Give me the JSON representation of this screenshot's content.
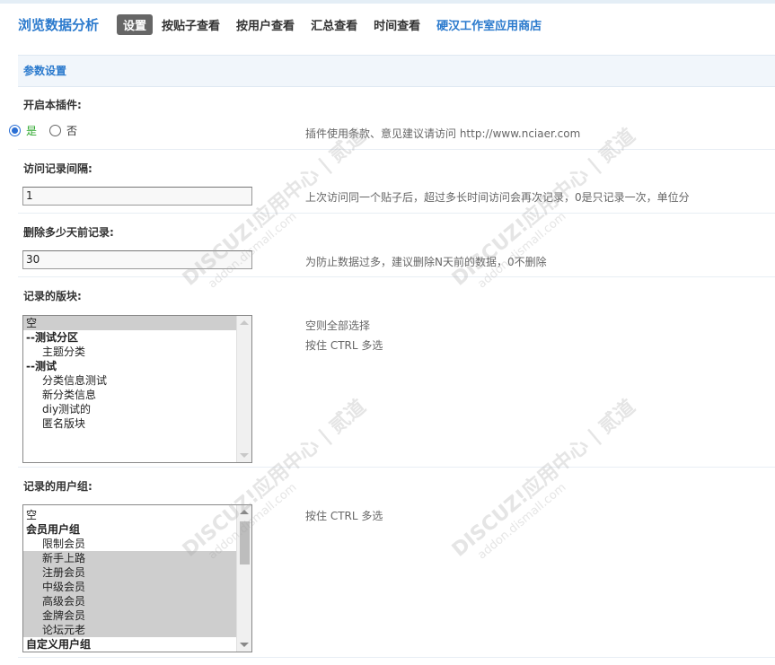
{
  "header": {
    "app_title": "浏览数据分析",
    "nav": [
      {
        "label": "设置",
        "active": true
      },
      {
        "label": "按贴子查看"
      },
      {
        "label": "按用户查看"
      },
      {
        "label": "汇总查看"
      },
      {
        "label": "时间查看"
      },
      {
        "label": "硬汉工作室应用商店"
      }
    ]
  },
  "section": {
    "title": "参数设置"
  },
  "enable_plugin": {
    "label": "开启本插件:",
    "yes_label": "是",
    "no_label": "否",
    "selected": "yes",
    "hint": "插件使用条款、意见建议请访问 http://www.nciaer.com"
  },
  "interval": {
    "label": "访问记录间隔:",
    "value": "1",
    "hint": "上次访问同一个贴子后，超过多长时间访问会再次记录，0是只记录一次，单位分"
  },
  "delete_days": {
    "label": "删除多少天前记录:",
    "value": "30",
    "hint": "为防止数据过多，建议删除N天前的数据，0不删除"
  },
  "forums": {
    "label": "记录的版块:",
    "hint1": "空则全部选择",
    "hint2": "按住 CTRL 多选",
    "options": [
      {
        "text": "空",
        "type": "plain",
        "selected": true
      },
      {
        "text": "--测试分区",
        "type": "group"
      },
      {
        "text": "主题分类",
        "type": "indent"
      },
      {
        "text": "--测试",
        "type": "group"
      },
      {
        "text": "分类信息测试",
        "type": "indent"
      },
      {
        "text": "新分类信息",
        "type": "indent"
      },
      {
        "text": "diy测试的",
        "type": "indent"
      },
      {
        "text": "匿名版块",
        "type": "indent"
      }
    ]
  },
  "usergroups": {
    "label": "记录的用户组:",
    "hint": "按住 CTRL 多选",
    "options": [
      {
        "text": "空",
        "type": "plain"
      },
      {
        "text": "会员用户组",
        "type": "group"
      },
      {
        "text": "限制会员",
        "type": "indent"
      },
      {
        "text": "新手上路",
        "type": "indent",
        "selected": true
      },
      {
        "text": "注册会员",
        "type": "indent",
        "selected": true
      },
      {
        "text": "中级会员",
        "type": "indent",
        "selected": true
      },
      {
        "text": "高级会员",
        "type": "indent",
        "selected": true
      },
      {
        "text": "金牌会员",
        "type": "indent",
        "selected": true
      },
      {
        "text": "论坛元老",
        "type": "indent",
        "selected": true
      },
      {
        "text": "自定义用户组",
        "type": "group"
      }
    ]
  },
  "watermark": {
    "brand": "DISCUZ!应用中心 | 贰道",
    "url": "addon.dismall.com"
  }
}
